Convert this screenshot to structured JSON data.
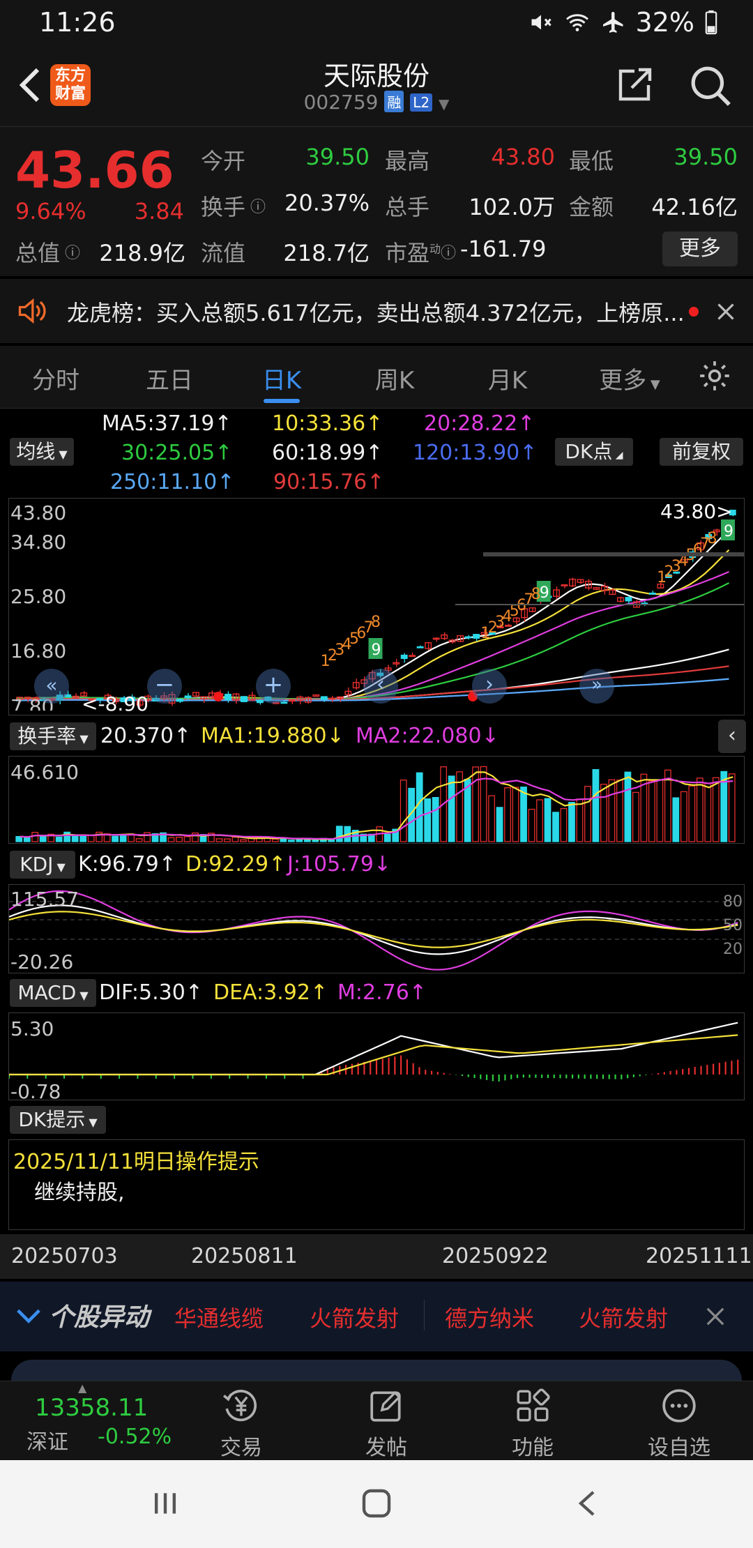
{
  "status": {
    "time": "11:26",
    "battery": "32%"
  },
  "header": {
    "logo_line1": "东方",
    "logo_line2": "财富",
    "title": "天际股份",
    "code": "002759",
    "tag_margin": "融",
    "tag_level": "L2"
  },
  "quote": {
    "last_price": "43.66",
    "change_pct": "9.64%",
    "change": "3.84",
    "open_label": "今开",
    "open": "39.50",
    "high_label": "最高",
    "high": "43.80",
    "low_label": "最低",
    "low": "39.50",
    "turnover_label": "换手",
    "turnover": "20.37%",
    "volume_label": "总手",
    "volume": "102.0万",
    "amount_label": "金额",
    "amount": "42.16亿",
    "mktcap_label": "总值",
    "mktcap": "218.9亿",
    "float_label": "流值",
    "float": "218.7亿",
    "pe_label": "市盈",
    "pe_sup": "动",
    "pe": "-161.79",
    "more_label": "更多"
  },
  "news": {
    "text": "龙虎榜：买入总额5.617亿元，卖出总额4.372亿元，上榜原..."
  },
  "tabs": [
    "分时",
    "五日",
    "日K",
    "周K",
    "月K",
    "更多"
  ],
  "ma_legend": {
    "selector": "均线",
    "ma5": "MA5:37.19↑",
    "ma10": "10:33.36↑",
    "ma20": "20:28.22↑",
    "ma30": "30:25.05↑",
    "ma60": "60:18.99↑",
    "ma120": "120:13.90↑",
    "ma250": "250:11.10↑",
    "ma90": "90:15.76↑",
    "dk_btn": "DK点",
    "fq_btn": "前复权"
  },
  "kline": {
    "y_labels": [
      "43.80",
      "34.80",
      "25.80",
      "16.80",
      "7.80"
    ],
    "high_marker": "43.80",
    "low_marker": "<-8.90",
    "nine_label": "9",
    "seq_labels": [
      "1",
      "2",
      "3",
      "4",
      "5",
      "6",
      "7",
      "8"
    ]
  },
  "turnover_panel": {
    "selector": "换手率",
    "value": "20.370↑",
    "ma1": "MA1:19.880↓",
    "ma2": "MA2:22.080↓",
    "y_top": "46.610"
  },
  "kdj_panel": {
    "selector": "KDJ",
    "k": "K:96.79↑",
    "d": "D:92.29↑",
    "j": "J:105.79↓",
    "y_top": "115.57",
    "y_bottom": "-20.26",
    "ref_80": "80",
    "ref_50": "50",
    "ref_20": "20"
  },
  "macd_panel": {
    "selector": "MACD",
    "dif": "DIF:5.30↑",
    "dea": "DEA:3.92↑",
    "m": "M:2.76↑",
    "y_top": "5.30",
    "y_bottom": "-0.78"
  },
  "dk_panel": {
    "selector": "DK提示",
    "date_title": "2025/11/11明日操作提示",
    "advice": "继续持股,"
  },
  "dates": [
    "20250703",
    "20250811",
    "20250922",
    "20251111"
  ],
  "stock_move": {
    "title": "个股异动",
    "items": [
      "华通线缆",
      "火箭发射",
      "德方纳米",
      "火箭发射"
    ]
  },
  "bottom_nav": {
    "index_value": "13358.11",
    "index_name": "深证",
    "index_change": "-0.52%",
    "trade": "交易",
    "post": "发帖",
    "func": "功能",
    "watch": "设自选"
  }
}
